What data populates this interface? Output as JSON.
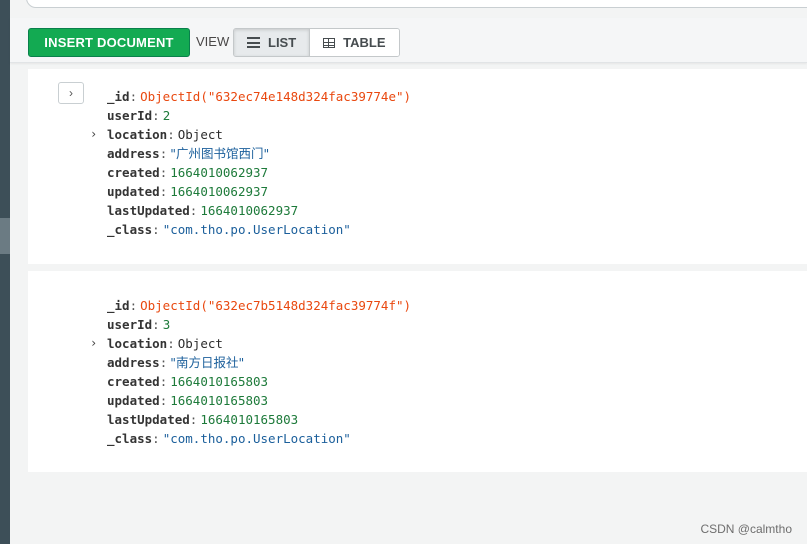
{
  "toolbar": {
    "insert_label": "INSERT DOCUMENT",
    "view_label": "VIEW",
    "list_label": "LIST",
    "table_label": "TABLE",
    "list_icon": "list-icon",
    "table_icon": "table-icon"
  },
  "documents": [
    {
      "expand_icon": "chevron-right-icon",
      "fields": [
        {
          "key": "_id",
          "value": "ObjectId(\"632ec74e148d324fac39774e\")",
          "type": "objectid"
        },
        {
          "key": "userId",
          "value": "2",
          "type": "number"
        },
        {
          "key": "location",
          "value": "Object",
          "type": "object",
          "collapsible": true
        },
        {
          "key": "address",
          "value": "\"广州图书馆西门\"",
          "type": "string"
        },
        {
          "key": "created",
          "value": "1664010062937",
          "type": "number"
        },
        {
          "key": "updated",
          "value": "1664010062937",
          "type": "number"
        },
        {
          "key": "lastUpdated",
          "value": "1664010062937",
          "type": "number"
        },
        {
          "key": "_class",
          "value": "\"com.tho.po.UserLocation\"",
          "type": "string"
        }
      ]
    },
    {
      "fields": [
        {
          "key": "_id",
          "value": "ObjectId(\"632ec7b5148d324fac39774f\")",
          "type": "objectid"
        },
        {
          "key": "userId",
          "value": "3",
          "type": "number"
        },
        {
          "key": "location",
          "value": "Object",
          "type": "object",
          "collapsible": true
        },
        {
          "key": "address",
          "value": "\"南方日报社\"",
          "type": "string"
        },
        {
          "key": "created",
          "value": "1664010165803",
          "type": "number"
        },
        {
          "key": "updated",
          "value": "1664010165803",
          "type": "number"
        },
        {
          "key": "lastUpdated",
          "value": "1664010165803",
          "type": "number"
        },
        {
          "key": "_class",
          "value": "\"com.tho.po.UserLocation\"",
          "type": "string"
        }
      ]
    }
  ],
  "watermark": "CSDN @calmtho",
  "colors": {
    "insert_button": "#13aa52",
    "objectid": "#e9480f",
    "number": "#1d7a3a",
    "string": "#1b5f9b"
  }
}
